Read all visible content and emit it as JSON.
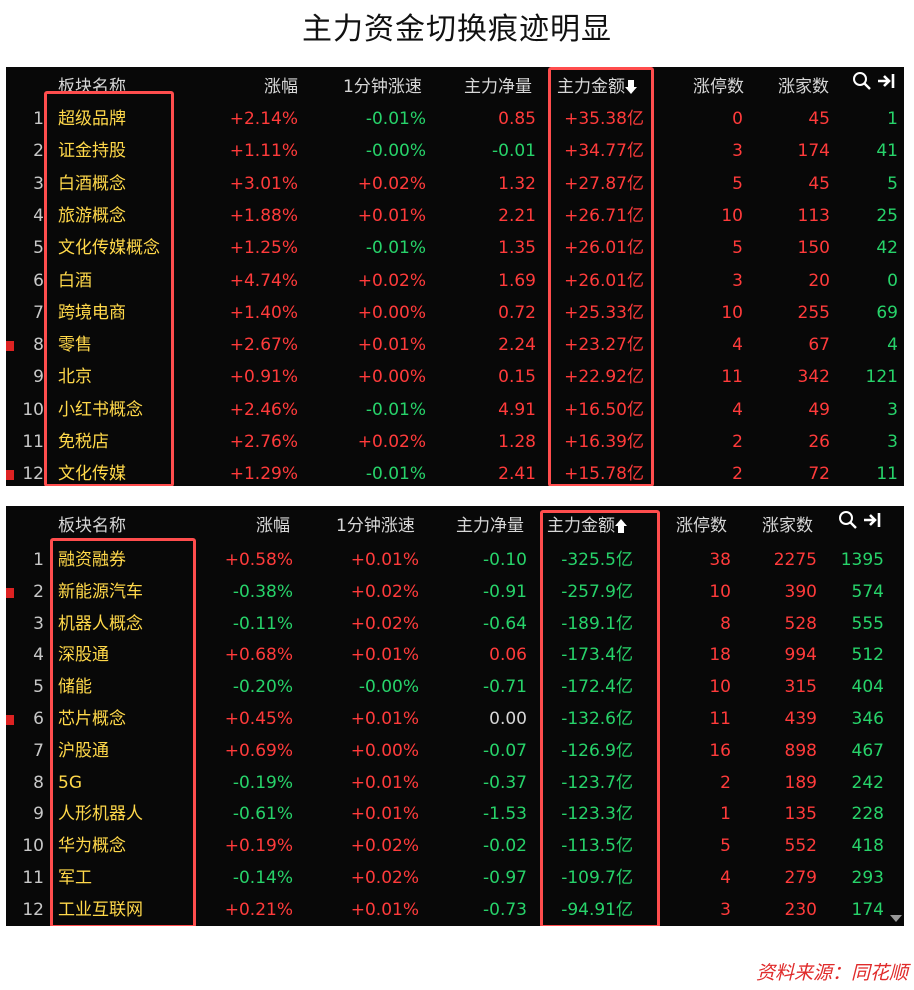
{
  "title": "主力资金切换痕迹明显",
  "source": "资料来源：同花顺",
  "colors": {
    "up": "#ff3b3b",
    "down": "#27d36a",
    "name": "#ffd84a",
    "highlight": "#ff4d4d"
  },
  "top": {
    "headers": {
      "name": "板块名称",
      "change": "涨幅",
      "speed": "1分钟涨速",
      "net": "主力净量",
      "amount": "主力金额",
      "limit_up": "涨停数",
      "rising": "涨家数"
    },
    "sort_indicator": "down-arrow",
    "rows": [
      {
        "idx": "1",
        "name": "超级品牌",
        "change": "+2.14%",
        "speed": "-0.01%",
        "net": "0.85",
        "amount": "+35.38亿",
        "limit_up": "0",
        "rising": "45",
        "extra": "1"
      },
      {
        "idx": "2",
        "name": "证金持股",
        "change": "+1.11%",
        "speed": "-0.00%",
        "net": "-0.01",
        "amount": "+34.77亿",
        "limit_up": "3",
        "rising": "174",
        "extra": "41"
      },
      {
        "idx": "3",
        "name": "白酒概念",
        "change": "+3.01%",
        "speed": "+0.02%",
        "net": "1.32",
        "amount": "+27.87亿",
        "limit_up": "5",
        "rising": "45",
        "extra": "5"
      },
      {
        "idx": "4",
        "name": "旅游概念",
        "change": "+1.88%",
        "speed": "+0.01%",
        "net": "2.21",
        "amount": "+26.71亿",
        "limit_up": "10",
        "rising": "113",
        "extra": "25"
      },
      {
        "idx": "5",
        "name": "文化传媒概念",
        "change": "+1.25%",
        "speed": "-0.01%",
        "net": "1.35",
        "amount": "+26.01亿",
        "limit_up": "5",
        "rising": "150",
        "extra": "42"
      },
      {
        "idx": "6",
        "name": "白酒",
        "change": "+4.74%",
        "speed": "+0.02%",
        "net": "1.69",
        "amount": "+26.01亿",
        "limit_up": "3",
        "rising": "20",
        "extra": "0"
      },
      {
        "idx": "7",
        "name": "跨境电商",
        "change": "+1.40%",
        "speed": "+0.00%",
        "net": "0.72",
        "amount": "+25.33亿",
        "limit_up": "10",
        "rising": "255",
        "extra": "69"
      },
      {
        "idx": "8",
        "name": "零售",
        "change": "+2.67%",
        "speed": "+0.01%",
        "net": "2.24",
        "amount": "+23.27亿",
        "limit_up": "4",
        "rising": "67",
        "extra": "4",
        "flag": true
      },
      {
        "idx": "9",
        "name": "北京",
        "change": "+0.91%",
        "speed": "+0.00%",
        "net": "0.15",
        "amount": "+22.92亿",
        "limit_up": "11",
        "rising": "342",
        "extra": "121"
      },
      {
        "idx": "10",
        "name": "小红书概念",
        "change": "+2.46%",
        "speed": "-0.01%",
        "net": "4.91",
        "amount": "+16.50亿",
        "limit_up": "4",
        "rising": "49",
        "extra": "3"
      },
      {
        "idx": "11",
        "name": "免税店",
        "change": "+2.76%",
        "speed": "+0.02%",
        "net": "1.28",
        "amount": "+16.39亿",
        "limit_up": "2",
        "rising": "26",
        "extra": "3"
      },
      {
        "idx": "12",
        "name": "文化传媒",
        "change": "+1.29%",
        "speed": "-0.01%",
        "net": "2.41",
        "amount": "+15.78亿",
        "limit_up": "2",
        "rising": "72",
        "extra": "11",
        "flag": true
      }
    ]
  },
  "bottom": {
    "headers": {
      "name": "板块名称",
      "change": "涨幅",
      "speed": "1分钟涨速",
      "net": "主力净量",
      "amount": "主力金额",
      "limit_up": "涨停数",
      "rising": "涨家数"
    },
    "sort_indicator": "up-arrow",
    "rows": [
      {
        "idx": "1",
        "name": "融资融券",
        "change": "+0.58%",
        "speed": "+0.01%",
        "net": "-0.10",
        "amount": "-325.5亿",
        "limit_up": "38",
        "rising": "2275",
        "extra": "1395"
      },
      {
        "idx": "2",
        "name": "新能源汽车",
        "change": "-0.38%",
        "speed": "+0.02%",
        "net": "-0.91",
        "amount": "-257.9亿",
        "limit_up": "10",
        "rising": "390",
        "extra": "574",
        "flag": true
      },
      {
        "idx": "3",
        "name": "机器人概念",
        "change": "-0.11%",
        "speed": "+0.02%",
        "net": "-0.64",
        "amount": "-189.1亿",
        "limit_up": "8",
        "rising": "528",
        "extra": "555"
      },
      {
        "idx": "4",
        "name": "深股通",
        "change": "+0.68%",
        "speed": "+0.01%",
        "net": "0.06",
        "amount": "-173.4亿",
        "limit_up": "18",
        "rising": "994",
        "extra": "512"
      },
      {
        "idx": "5",
        "name": "储能",
        "change": "-0.20%",
        "speed": "-0.00%",
        "net": "-0.71",
        "amount": "-172.4亿",
        "limit_up": "10",
        "rising": "315",
        "extra": "404"
      },
      {
        "idx": "6",
        "name": "芯片概念",
        "change": "+0.45%",
        "speed": "+0.01%",
        "net": "0.00",
        "amount": "-132.6亿",
        "limit_up": "11",
        "rising": "439",
        "extra": "346",
        "flag": true
      },
      {
        "idx": "7",
        "name": "沪股通",
        "change": "+0.69%",
        "speed": "+0.00%",
        "net": "-0.07",
        "amount": "-126.9亿",
        "limit_up": "16",
        "rising": "898",
        "extra": "467"
      },
      {
        "idx": "8",
        "name": "5G",
        "change": "-0.19%",
        "speed": "+0.01%",
        "net": "-0.37",
        "amount": "-123.7亿",
        "limit_up": "2",
        "rising": "189",
        "extra": "242"
      },
      {
        "idx": "9",
        "name": "人形机器人",
        "change": "-0.61%",
        "speed": "+0.01%",
        "net": "-1.53",
        "amount": "-123.3亿",
        "limit_up": "1",
        "rising": "135",
        "extra": "228"
      },
      {
        "idx": "10",
        "name": "华为概念",
        "change": "+0.19%",
        "speed": "+0.02%",
        "net": "-0.02",
        "amount": "-113.5亿",
        "limit_up": "5",
        "rising": "552",
        "extra": "418"
      },
      {
        "idx": "11",
        "name": "军工",
        "change": "-0.14%",
        "speed": "+0.02%",
        "net": "-0.97",
        "amount": "-109.7亿",
        "limit_up": "4",
        "rising": "279",
        "extra": "293"
      },
      {
        "idx": "12",
        "name": "工业互联网",
        "change": "+0.21%",
        "speed": "+0.01%",
        "net": "-0.73",
        "amount": "-94.91亿",
        "limit_up": "3",
        "rising": "230",
        "extra": "174"
      }
    ]
  }
}
